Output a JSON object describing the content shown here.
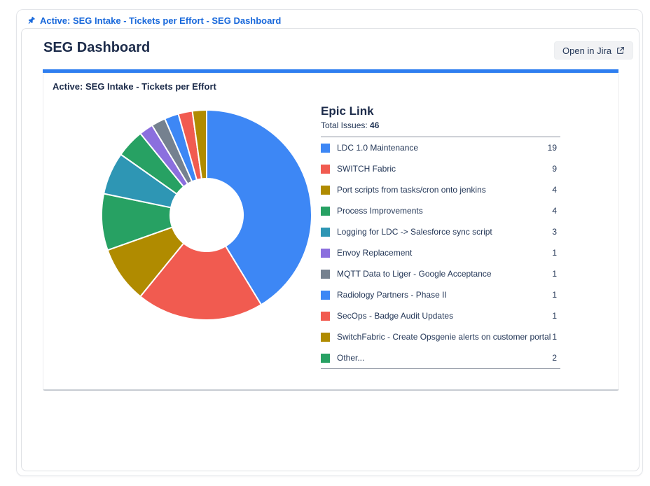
{
  "window": {
    "pinned_title": "Active: SEG Intake - Tickets per Effort - SEG Dashboard"
  },
  "header": {
    "title": "SEG Dashboard",
    "open_button_label": "Open in Jira"
  },
  "panel": {
    "title": "Active: SEG Intake - Tickets per Effort"
  },
  "legend": {
    "title": "Epic Link",
    "total_label": "Total Issues:",
    "total_value": "46"
  },
  "colors": {
    "accent_blue": "#2e7ef0",
    "link_blue": "#1868db",
    "navy_text": "#172b4d"
  },
  "chart_data": {
    "type": "pie",
    "title": "Active: SEG Intake - Tickets per Effort",
    "donut": true,
    "total_issues": 46,
    "legend_title": "Epic Link",
    "items": [
      {
        "label": "LDC 1.0 Maintenance",
        "value": 19,
        "color": "#3d87f5"
      },
      {
        "label": "SWITCH Fabric",
        "value": 9,
        "color": "#f15b50"
      },
      {
        "label": "Port scripts from tasks/cron onto jenkins",
        "value": 4,
        "color": "#b08b00"
      },
      {
        "label": "Process Improvements",
        "value": 4,
        "color": "#27a163"
      },
      {
        "label": "Logging for LDC -> Salesforce sync script",
        "value": 3,
        "color": "#2e96b4"
      },
      {
        "label": "Envoy Replacement",
        "value": 1,
        "color": "#8b6fde"
      },
      {
        "label": "MQTT Data to Liger - Google Acceptance",
        "value": 1,
        "color": "#75818f"
      },
      {
        "label": "Radiology Partners - Phase II",
        "value": 1,
        "color": "#3d87f5"
      },
      {
        "label": "SecOps - Badge Audit Updates",
        "value": 1,
        "color": "#f15b50"
      },
      {
        "label": "SwitchFabric - Create Opsgenie alerts on customer portal err...",
        "value": 1,
        "color": "#b08b00"
      },
      {
        "label": "Other...",
        "value": 2,
        "color": "#27a163"
      }
    ],
    "pie_order": [
      0,
      1,
      2,
      3,
      4,
      10,
      5,
      6,
      7,
      8,
      9
    ],
    "start_angle_deg": 0,
    "direction": "clockwise",
    "legend_position": "right"
  }
}
